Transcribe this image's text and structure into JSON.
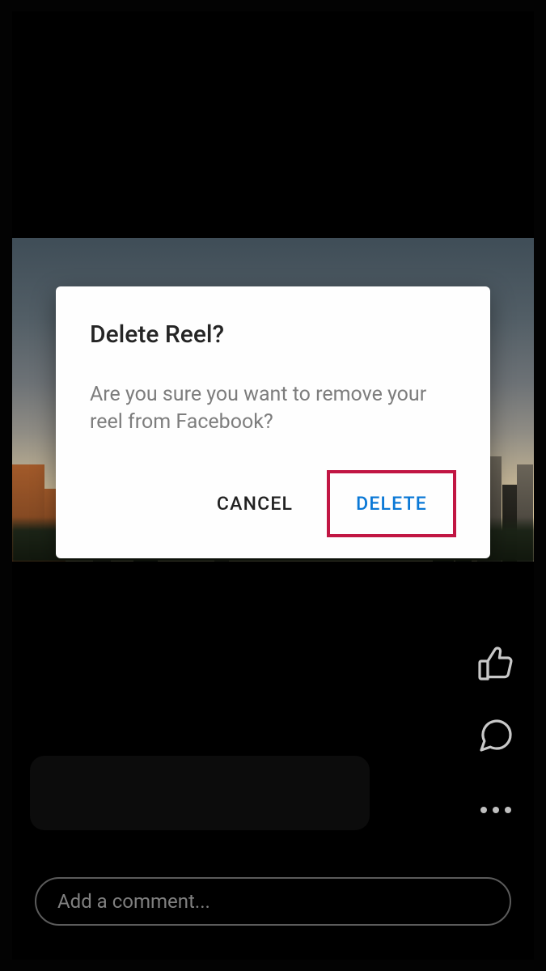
{
  "dialog": {
    "title": "Delete Reel?",
    "message": "Are you sure you want to remove your reel from Facebook?",
    "cancel_label": "CANCEL",
    "delete_label": "DELETE"
  },
  "actions": {
    "like_icon": "thumbs-up-icon",
    "comment_icon": "speech-bubble-icon",
    "more_icon": "more-horizontal-icon"
  },
  "comment_input": {
    "placeholder": "Add a comment..."
  }
}
